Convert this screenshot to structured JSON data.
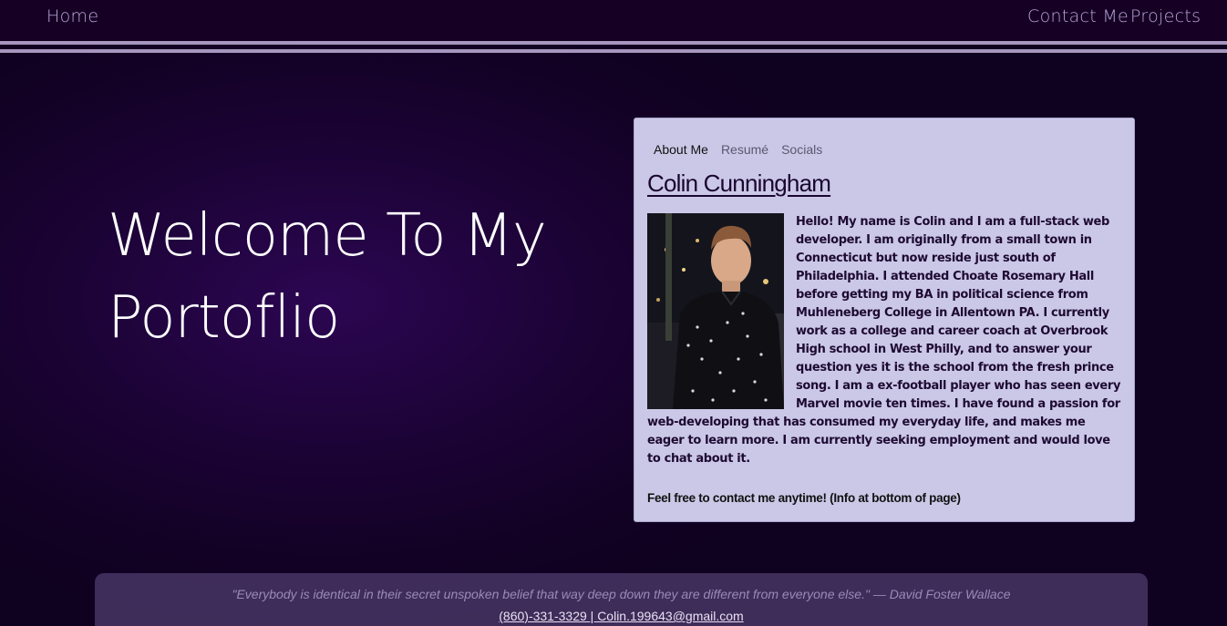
{
  "nav": {
    "home_label": "Home",
    "contact_label": "Contact Me",
    "projects_label": "Projects"
  },
  "hero": {
    "title": "Welcome To My Portoflio"
  },
  "card": {
    "tabs": [
      {
        "label": "About Me",
        "active": true
      },
      {
        "label": "Resumé",
        "active": false
      },
      {
        "label": "Socials",
        "active": false
      }
    ],
    "name": "Colin Cunningham",
    "photo_alt": "photo-portrait",
    "bio": "Hello! My name is Colin and I am a full-stack web developer. I am originally from a small town in Connecticut but now reside just south of Philadelphia. I attended Choate Rosemary Hall before getting my BA in political science from Muhleneberg College in Allentown PA. I currently work as a college and career coach at Overbrook High school in West Philly, and to answer your question yes it is the school from the fresh prince song. I am a ex-football player who has seen every Marvel movie ten times. I have found a passion for web-developing that has consumed my everyday life, and makes me eager to learn more. I am currently seeking employment and would love to chat about it.",
    "contact_note": "Feel free to contact me anytime! (Info at bottom of page)"
  },
  "footer": {
    "quote": "\"Everybody is identical in their secret unspoken belief that way deep down they are different from everyone else.\" — David Foster Wallace",
    "contact": "(860)-331-3329 | Colin.199643@gmail.com"
  },
  "colors": {
    "background": "#12011f",
    "nav_link": "#b6a5d8",
    "card_bg": "#cbc8e7",
    "rule": "#a796bd"
  }
}
